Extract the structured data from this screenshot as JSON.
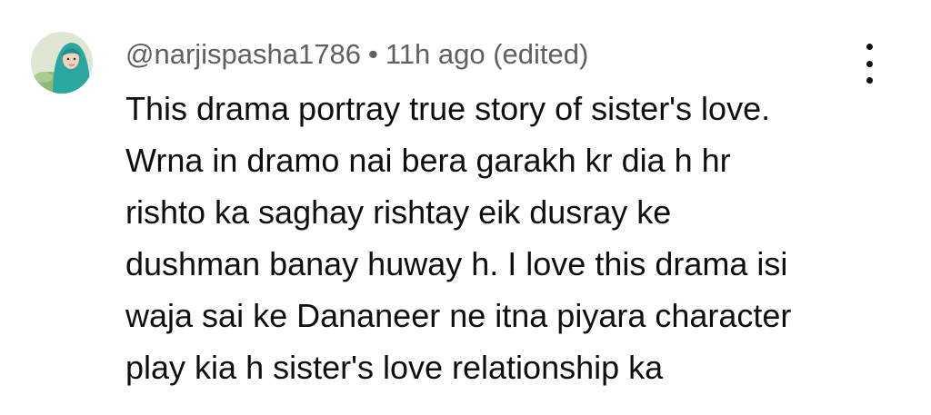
{
  "comment": {
    "author_handle": "@narjispasha1786",
    "separator": "•",
    "timestamp": "11h ago",
    "edited_label": "(edited)",
    "body_lines": [
      "This drama portray true story of sister's love.",
      "Wrna in dramo nai bera garakh kr dia h hr",
      "rishto ka saghay rishtay eik dusray ke",
      "dushman banay huway h. I love this drama isi",
      "waja sai ke Dananeer ne itna piyara character",
      "play kia h sister's love relationship ka"
    ],
    "avatar_icon": "user-avatar",
    "menu_icon": "more-vertical-icon"
  },
  "colors": {
    "text_primary": "#0f0f0f",
    "text_secondary": "#606060",
    "avatar_hijab": "#2aa7a0",
    "background": "#ffffff"
  }
}
